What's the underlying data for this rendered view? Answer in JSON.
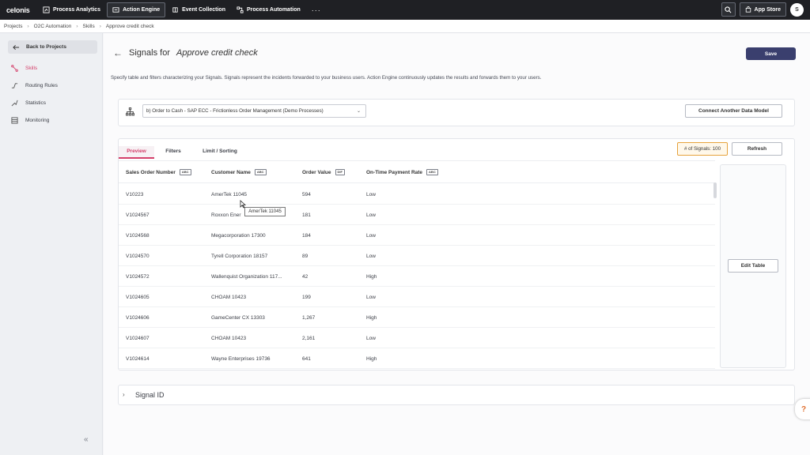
{
  "app": {
    "logo": "celonis"
  },
  "topnav": {
    "items": [
      {
        "label": "Process Analytics",
        "icon": "analytics-icon",
        "active": false
      },
      {
        "label": "Action Engine",
        "icon": "action-engine-icon",
        "active": true
      },
      {
        "label": "Event Collection",
        "icon": "event-collection-icon",
        "active": false
      },
      {
        "label": "Process Automation",
        "icon": "automation-icon",
        "active": false
      }
    ],
    "more": "···",
    "app_store": "App Store",
    "avatar_initial": "S"
  },
  "breadcrumb": [
    "Projects",
    "O2C Automation",
    "Skills",
    "Approve credit check"
  ],
  "sidebar": {
    "back": "Back to Projects",
    "items": [
      {
        "label": "Skills",
        "active": true
      },
      {
        "label": "Routing Rules",
        "active": false
      },
      {
        "label": "Statistics",
        "active": false
      },
      {
        "label": "Monitoring",
        "active": false
      }
    ]
  },
  "main": {
    "title_prefix": "Signals for",
    "title_skill": "Approve credit check",
    "save": "Save",
    "description": "Specify table and filters characterizing your Signals. Signals represent the incidents forwarded to your business users. Action Engine continuously updates the results and forwards them to your users.",
    "data_model": "b) Order to Cash - SAP ECC - Frictionless Order Management (Demo Processes)",
    "connect": "Connect Another Data Model",
    "tabs": [
      "Preview",
      "Filters",
      "Limit / Sorting"
    ],
    "signals_count": "# of Signals: 100",
    "refresh": "Refresh",
    "edit_table": "Edit Table",
    "tooltip": "AmerTek 11045",
    "signal_id": "Signal ID"
  },
  "table": {
    "columns": [
      {
        "label": "Sales Order Number",
        "type": "ABC"
      },
      {
        "label": "Customer Name",
        "type": "ABC"
      },
      {
        "label": "Order Value",
        "type": "DIF"
      },
      {
        "label": "On-Time Payment Rate",
        "type": "ABC"
      }
    ],
    "rows": [
      [
        "V10223",
        "AmerTek 11045",
        "594",
        "Low"
      ],
      [
        "V1024567",
        "Roxxon Ener",
        "181",
        "Low"
      ],
      [
        "V1024568",
        "Megacorporation 17300",
        "184",
        "Low"
      ],
      [
        "V1024570",
        "Tyrell Corporation 18157",
        "89",
        "Low"
      ],
      [
        "V1024572",
        "Wallenquist Organization 117...",
        "42",
        "High"
      ],
      [
        "V1024605",
        "CHOAM 10423",
        "199",
        "Low"
      ],
      [
        "V1024606",
        "GameCenter CX 13303",
        "1,267",
        "High"
      ],
      [
        "V1024607",
        "CHOAM 10423",
        "2,161",
        "Low"
      ],
      [
        "V1024614",
        "Wayne Enterprises 19736",
        "641",
        "High"
      ]
    ]
  },
  "colors": {
    "accent": "#d43f6a",
    "primary_button": "#3a3f6e",
    "topbar": "#1f2024",
    "badge_border": "#e6a23c"
  }
}
